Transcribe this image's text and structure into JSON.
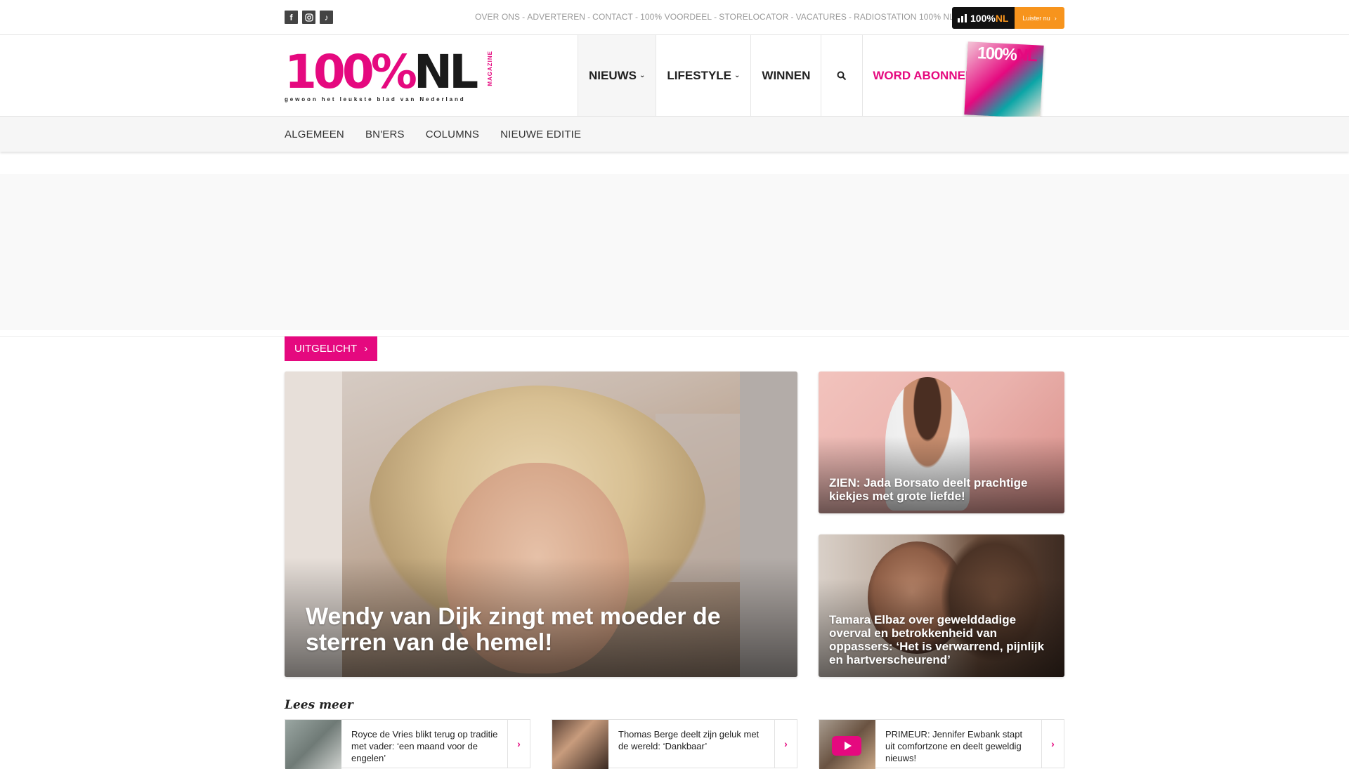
{
  "topbar": {
    "social": [
      {
        "name": "facebook-icon",
        "glyph": "f"
      },
      {
        "name": "instagram-icon",
        "glyph": ""
      },
      {
        "name": "tiktok-icon",
        "glyph": "♪"
      }
    ],
    "links": [
      "OVER ONS",
      "ADVERTEREN",
      "CONTACT",
      "100% VOORDEEL",
      "STORELOCATOR",
      "VACATURES",
      "RADIOSTATION 100% NL"
    ],
    "separator": "-",
    "radio": {
      "logo_text": "100%",
      "logo_nl": "NL",
      "cta": "Luister nu",
      "cta_arrow": "›"
    }
  },
  "header": {
    "logo": {
      "main": "100%",
      "nl": "NL",
      "magazine": "MAGAZINE",
      "tagline": "gewoon het leukste blad van Nederland"
    },
    "nav": [
      {
        "label": "NIEUWS",
        "has_dropdown": true
      },
      {
        "label": "LIFESTYLE",
        "has_dropdown": true
      },
      {
        "label": "WINNEN",
        "has_dropdown": false
      }
    ],
    "subscribe": "WORD ABONNEE",
    "cover": {
      "title": "100%",
      "title_nl": "NL"
    }
  },
  "subnav": [
    "ALGEMEEN",
    "BN'ERS",
    "COLUMNS",
    "NIEUWE EDITIE"
  ],
  "featured": {
    "badge": "UITGELICHT",
    "badge_arrow": "›",
    "main": {
      "title": "Wendy van Dijk zingt met moeder de sterren van de hemel!"
    },
    "side": [
      {
        "title": "ZIEN: Jada Borsato deelt prachtige kiekjes met grote liefde!"
      },
      {
        "title": "Tamara Elbaz over gewelddadige overval en betrokkenheid van oppassers: ‘Het is verwarrend, pijnlijk en hartverscheurend’"
      }
    ]
  },
  "lees_meer": {
    "heading": "Lees meer",
    "arrow": "›",
    "items": [
      {
        "title": "Royce de Vries blikt terug op traditie met vader: ‘een maand voor de engelen’"
      },
      {
        "title": "Thomas Berge deelt zijn geluk met de wereld: ‘Dankbaar’"
      },
      {
        "title": "PRIMEUR: Jennifer Ewbank stapt uit comfortzone en deelt geweldig nieuws!"
      }
    ]
  },
  "colors": {
    "accent": "#e5097f",
    "radio_orange": "#f7941d",
    "dark": "#1a1a1a"
  }
}
